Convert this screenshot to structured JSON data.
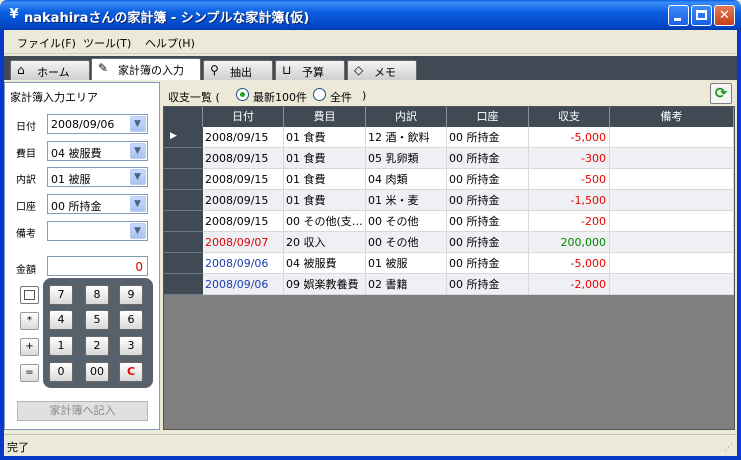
{
  "window": {
    "title": "nakahiraさんの家計簿 - シンプルな家計簿(仮)",
    "icon": "yen-icon"
  },
  "menu": [
    "ファイル(F)",
    "ツール(T)",
    "ヘルプ(H)"
  ],
  "tabs": [
    {
      "label": "ホーム",
      "icon": "home-icon",
      "active": false
    },
    {
      "label": "家計簿の入力",
      "icon": "pencil-icon",
      "active": true
    },
    {
      "label": "抽出",
      "icon": "magnifier-icon",
      "active": false
    },
    {
      "label": "予算",
      "icon": "cart-icon",
      "active": false
    },
    {
      "label": "メモ",
      "icon": "eraser-icon",
      "active": false
    }
  ],
  "entry": {
    "title": "家計簿入力エリア",
    "fields": [
      {
        "label": "日付",
        "value": "2008/09/06"
      },
      {
        "label": "費目",
        "value": "04 被服費"
      },
      {
        "label": "内訳",
        "value": "01 被服"
      },
      {
        "label": "口座",
        "value": "00 所持金"
      },
      {
        "label": "備考",
        "value": ""
      }
    ],
    "amount_label": "金額",
    "amount_value": "0",
    "keys": [
      "7",
      "8",
      "9",
      "4",
      "5",
      "6",
      "1",
      "2",
      "3",
      "0",
      "00",
      "C"
    ],
    "ops": [
      "",
      "*",
      "+",
      "="
    ],
    "submit_label": "家計簿へ記入"
  },
  "list": {
    "title": "収支一覧 (",
    "filter_options": [
      "最新100件",
      "全件"
    ],
    "filter_selected": "最新100件",
    "title_close": ")",
    "columns": [
      "日付",
      "費目",
      "内訳",
      "口座",
      "収支",
      "備考"
    ],
    "rows": [
      {
        "date": "2008/09/15",
        "category": "01 食費",
        "detail": "12 酒・飲料",
        "account": "00 所持金",
        "amount": "-5,000",
        "note": "",
        "date_color": "black",
        "selected": true
      },
      {
        "date": "2008/09/15",
        "category": "01 食費",
        "detail": "05 乳卵類",
        "account": "00 所持金",
        "amount": "-300",
        "note": "",
        "date_color": "black",
        "selected": false
      },
      {
        "date": "2008/09/15",
        "category": "01 食費",
        "detail": "04 肉類",
        "account": "00 所持金",
        "amount": "-500",
        "note": "",
        "date_color": "black",
        "selected": false
      },
      {
        "date": "2008/09/15",
        "category": "01 食費",
        "detail": "01 米・麦",
        "account": "00 所持金",
        "amount": "-1,500",
        "note": "",
        "date_color": "black",
        "selected": false
      },
      {
        "date": "2008/09/15",
        "category": "00 その他(支…",
        "detail": "00 その他",
        "account": "00 所持金",
        "amount": "-200",
        "note": "",
        "date_color": "black",
        "selected": false
      },
      {
        "date": "2008/09/07",
        "category": "20 収入",
        "detail": "00 その他",
        "account": "00 所持金",
        "amount": "200,000",
        "note": "",
        "date_color": "red",
        "selected": false
      },
      {
        "date": "2008/09/06",
        "category": "04 被服費",
        "detail": "01 被服",
        "account": "00 所持金",
        "amount": "-5,000",
        "note": "",
        "date_color": "blue",
        "selected": false
      },
      {
        "date": "2008/09/06",
        "category": "09 娯楽教養費",
        "detail": "02 書籍",
        "account": "00 所持金",
        "amount": "-2,000",
        "note": "",
        "date_color": "blue",
        "selected": false
      }
    ]
  },
  "status": "完了",
  "colors": {
    "titlebar": "#0a5fe0",
    "grid_header": "#3f4a54",
    "negative": "#e00000",
    "positive": "#008000",
    "saturday": "#1a3db0",
    "sunday": "#d00000"
  }
}
